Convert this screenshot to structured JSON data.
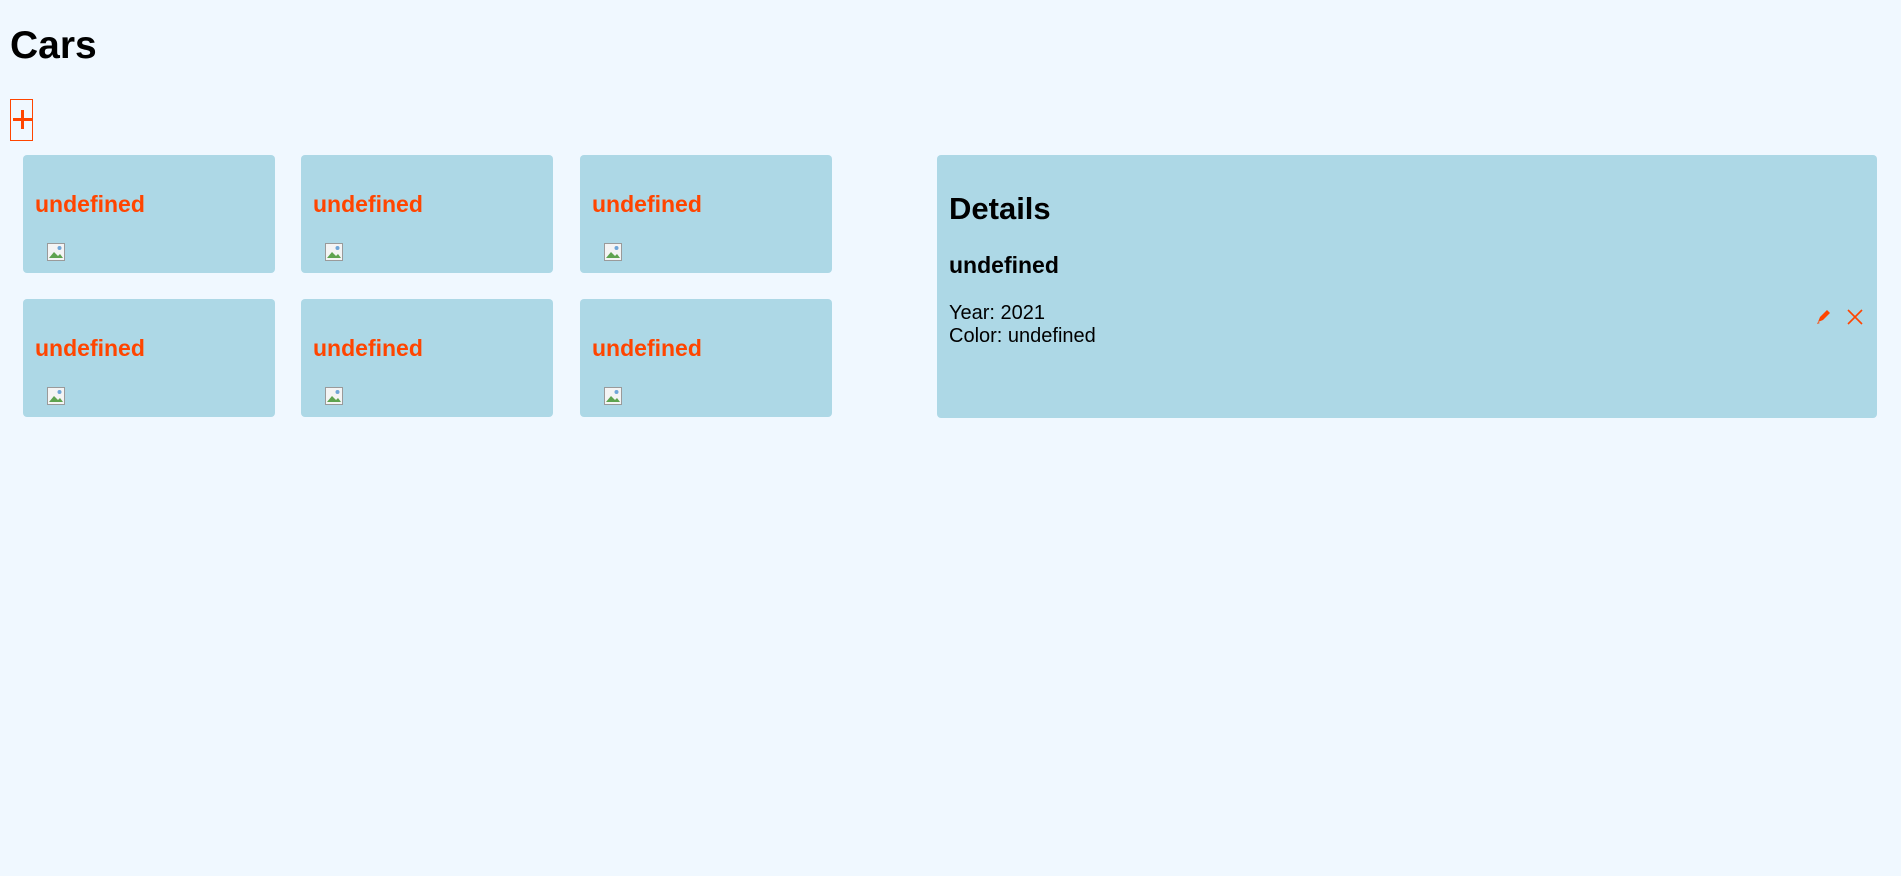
{
  "page": {
    "title": "Cars",
    "add_icon": "plus-icon"
  },
  "cars": [
    {
      "name": "undefined",
      "image_icon": "broken-image-icon"
    },
    {
      "name": "undefined",
      "image_icon": "broken-image-icon"
    },
    {
      "name": "undefined",
      "image_icon": "broken-image-icon"
    },
    {
      "name": "undefined",
      "image_icon": "broken-image-icon"
    },
    {
      "name": "undefined",
      "image_icon": "broken-image-icon"
    },
    {
      "name": "undefined",
      "image_icon": "broken-image-icon"
    }
  ],
  "details": {
    "heading": "Details",
    "name": "undefined",
    "year_line": "Year: 2021",
    "color_line": "Color: undefined",
    "edit_icon": "pencil-icon",
    "delete_icon": "close-icon"
  },
  "colors": {
    "background": "#f0f8ff",
    "card": "#add8e6",
    "accent": "#ff4500",
    "text": "#000000"
  }
}
